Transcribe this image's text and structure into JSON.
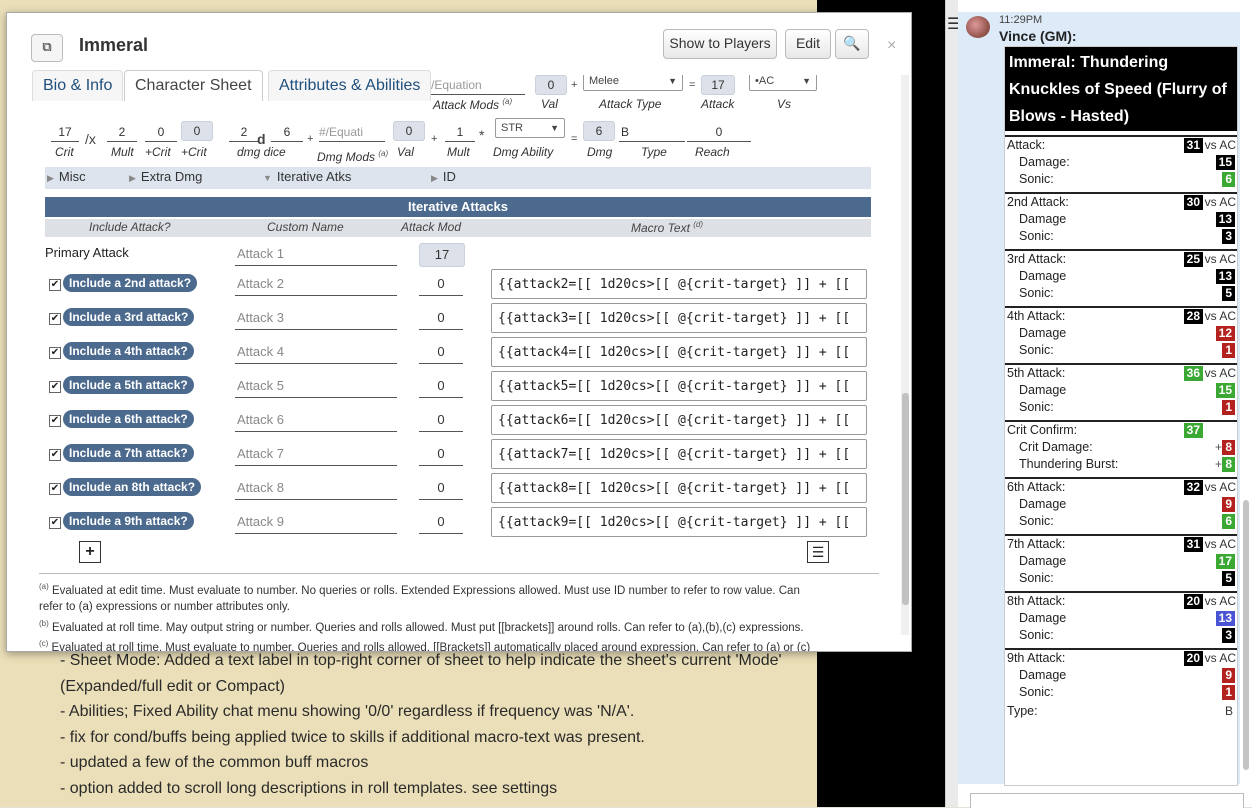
{
  "dialog": {
    "title": "Immeral",
    "buttons": {
      "show": "Show to Players",
      "edit": "Edit",
      "search_icon": "search-icon",
      "popout_icon": "popout-icon"
    },
    "close": "×",
    "tabs": [
      "Bio & Info",
      "Character Sheet",
      "Attributes & Abilities"
    ]
  },
  "top_row": {
    "equation_placeholder": "/Equation",
    "val": "0",
    "attack_type": "Melee",
    "attack": "17",
    "vs_sel": "•AC",
    "captions": {
      "attack_mods": "Attack Mods",
      "val": "Val",
      "attack_type": "Attack Type",
      "attack": "Attack",
      "vs": "Vs"
    },
    "sup_a": "(a)"
  },
  "dmg_row": {
    "crit": "17",
    "slash": "/x",
    "mult": "2",
    "plus_crit1": "0",
    "plus_crit2": "0",
    "dmg_dice": "2",
    "d": "d",
    "dice_sides": "6",
    "dmg_mods_placeholder": "#/Equati",
    "val": "0",
    "mult2": "1",
    "dmg_ability": "STR",
    "dmg": "6",
    "type": "B",
    "reach": "0",
    "captions": {
      "crit": "Crit",
      "mult": "Mult",
      "plus_crit1": "+Crit",
      "plus_crit2": "+Crit",
      "dmg_dice": "dmg dice",
      "dmg_mods": "Dmg Mods",
      "val": "Val",
      "mult2": "Mult",
      "dmg_ability": "Dmg Ability",
      "dmg": "Dmg",
      "type": "Type",
      "reach": "Reach"
    }
  },
  "toggles": [
    "Misc",
    "Extra Dmg",
    "Iterative Atks",
    "ID"
  ],
  "iterative": {
    "heading": "Iterative Attacks",
    "columns": [
      "Include Attack?",
      "Custom Name",
      "Attack Mod",
      "Macro Text"
    ],
    "macro_sup": "(d)",
    "primary": {
      "label": "Primary Attack",
      "name": "Attack 1",
      "mod": "17"
    },
    "rows": [
      {
        "label": "Include a 2nd attack?",
        "name": "Attack 2",
        "mod": "0",
        "macro": "{{attack2=[[ 1d20cs>[[ @{crit-target} ]] + [["
      },
      {
        "label": "Include a 3rd attack?",
        "name": "Attack 3",
        "mod": "0",
        "macro": "{{attack3=[[ 1d20cs>[[ @{crit-target} ]] + [["
      },
      {
        "label": "Include a 4th attack?",
        "name": "Attack 4",
        "mod": "0",
        "macro": "{{attack4=[[ 1d20cs>[[ @{crit-target} ]] + [["
      },
      {
        "label": "Include a 5th attack?",
        "name": "Attack 5",
        "mod": "0",
        "macro": "{{attack5=[[ 1d20cs>[[ @{crit-target} ]] + [["
      },
      {
        "label": "Include a 6th attack?",
        "name": "Attack 6",
        "mod": "0",
        "macro": "{{attack6=[[ 1d20cs>[[ @{crit-target} ]] + [["
      },
      {
        "label": "Include a 7th attack?",
        "name": "Attack 7",
        "mod": "0",
        "macro": "{{attack7=[[ 1d20cs>[[ @{crit-target} ]] + [["
      },
      {
        "label": "Include an 8th attack?",
        "name": "Attack 8",
        "mod": "0",
        "macro": "{{attack8=[[ 1d20cs>[[ @{crit-target} ]] + [["
      },
      {
        "label": "Include a 9th attack?",
        "name": "Attack 9",
        "mod": "0",
        "macro": "{{attack9=[[ 1d20cs>[[ @{crit-target} ]] + [["
      }
    ]
  },
  "bottom": {
    "add": "+",
    "list": "☰"
  },
  "notes": [
    {
      "sup": "(a)",
      "text": " Evaluated at edit time. Must evaluate to number. No queries or rolls. Extended Expressions allowed. Must use ID number to refer to row value. Can"
    },
    {
      "sup": "",
      "text": "   refer to (a) expressions or number attributes only."
    },
    {
      "sup": "(b)",
      "text": " Evaluated at roll time. May output string or number. Queries and rolls allowed. Must put [[brackets]] around rolls. Can refer to (a),(b),(c) expressions."
    },
    {
      "sup": "(c)",
      "text": " Evaluated at roll time. Must evaluate to number. Queries and rolls allowed. [[Brackets]] automatically placed around expression. Can refer to (a) or (c)"
    }
  ],
  "background_notes": [
    "- Sheet Mode: Added a text label in top-right corner of sheet to help indicate the sheet's current 'Mode'",
    "(Expanded/full edit or Compact)",
    "- Abilities; Fixed Ability chat menu showing '0/0' regardless if frequency was 'N/A'.",
    "- fix for cond/buffs being applied twice to skills if additional macro-text was present.",
    "- updated a few of the common buff macros",
    "- option added to scroll long descriptions in roll templates. see settings"
  ],
  "chat": {
    "time": "11:29PM",
    "by": "Vince (GM):",
    "title": "Immeral: Thundering Knuckles of Speed (Flurry of Blows - Hasted)",
    "blocks": [
      {
        "label": "Attack:",
        "value": "31",
        "vs": "vs AC",
        "color": "#000000",
        "lines": [
          {
            "label": "Damage:",
            "value": "15",
            "color": "#000000"
          },
          {
            "label": "Sonic:",
            "value": "6",
            "color": "#3aa832"
          }
        ]
      },
      {
        "label": "2nd Attack:",
        "value": "30",
        "vs": "vs AC",
        "color": "#000000",
        "lines": [
          {
            "label": "Damage",
            "value": "13",
            "color": "#000000"
          },
          {
            "label": "Sonic:",
            "value": "3",
            "color": "#000000"
          }
        ]
      },
      {
        "label": "3rd Attack:",
        "value": "25",
        "vs": "vs AC",
        "color": "#000000",
        "lines": [
          {
            "label": "Damage",
            "value": "13",
            "color": "#000000"
          },
          {
            "label": "Sonic:",
            "value": "5",
            "color": "#000000"
          }
        ]
      },
      {
        "label": "4th Attack:",
        "value": "28",
        "vs": "vs AC",
        "color": "#000000",
        "lines": [
          {
            "label": "Damage",
            "value": "12",
            "color": "#b3221f"
          },
          {
            "label": "Sonic:",
            "value": "1",
            "color": "#b3221f"
          }
        ]
      },
      {
        "label": "5th Attack:",
        "value": "36",
        "vs": "vs AC",
        "color": "#3aa832",
        "lines": [
          {
            "label": "Damage",
            "value": "15",
            "color": "#3aa832"
          },
          {
            "label": "Sonic:",
            "value": "1",
            "color": "#b3221f"
          }
        ]
      },
      {
        "label": "Crit Confirm:",
        "value": "37",
        "vs": "",
        "color": "#3aa832",
        "lines": [
          {
            "label": "Crit Damage:",
            "value": "8",
            "prefix": "+",
            "color": "#b3221f"
          },
          {
            "label": "Thundering Burst:",
            "value": "8",
            "prefix": "+",
            "color": "#3aa832"
          }
        ]
      },
      {
        "label": "6th Attack:",
        "value": "32",
        "vs": "vs AC",
        "color": "#000000",
        "lines": [
          {
            "label": "Damage",
            "value": "9",
            "color": "#b3221f"
          },
          {
            "label": "Sonic:",
            "value": "6",
            "color": "#3aa832"
          }
        ]
      },
      {
        "label": "7th Attack:",
        "value": "31",
        "vs": "vs AC",
        "color": "#000000",
        "lines": [
          {
            "label": "Damage",
            "value": "17",
            "color": "#3aa832"
          },
          {
            "label": "Sonic:",
            "value": "5",
            "color": "#000000"
          }
        ]
      },
      {
        "label": "8th Attack:",
        "value": "20",
        "vs": "vs AC",
        "color": "#000000",
        "lines": [
          {
            "label": "Damage",
            "value": "13",
            "color": "#4a55d6"
          },
          {
            "label": "Sonic:",
            "value": "3",
            "color": "#000000"
          }
        ]
      },
      {
        "label": "9th Attack:",
        "value": "20",
        "vs": "vs AC",
        "color": "#000000",
        "lines": [
          {
            "label": "Damage",
            "value": "9",
            "color": "#b3221f"
          },
          {
            "label": "Sonic:",
            "value": "1",
            "color": "#b3221f"
          }
        ]
      }
    ],
    "type_label": "Type:",
    "type_value": "B"
  }
}
